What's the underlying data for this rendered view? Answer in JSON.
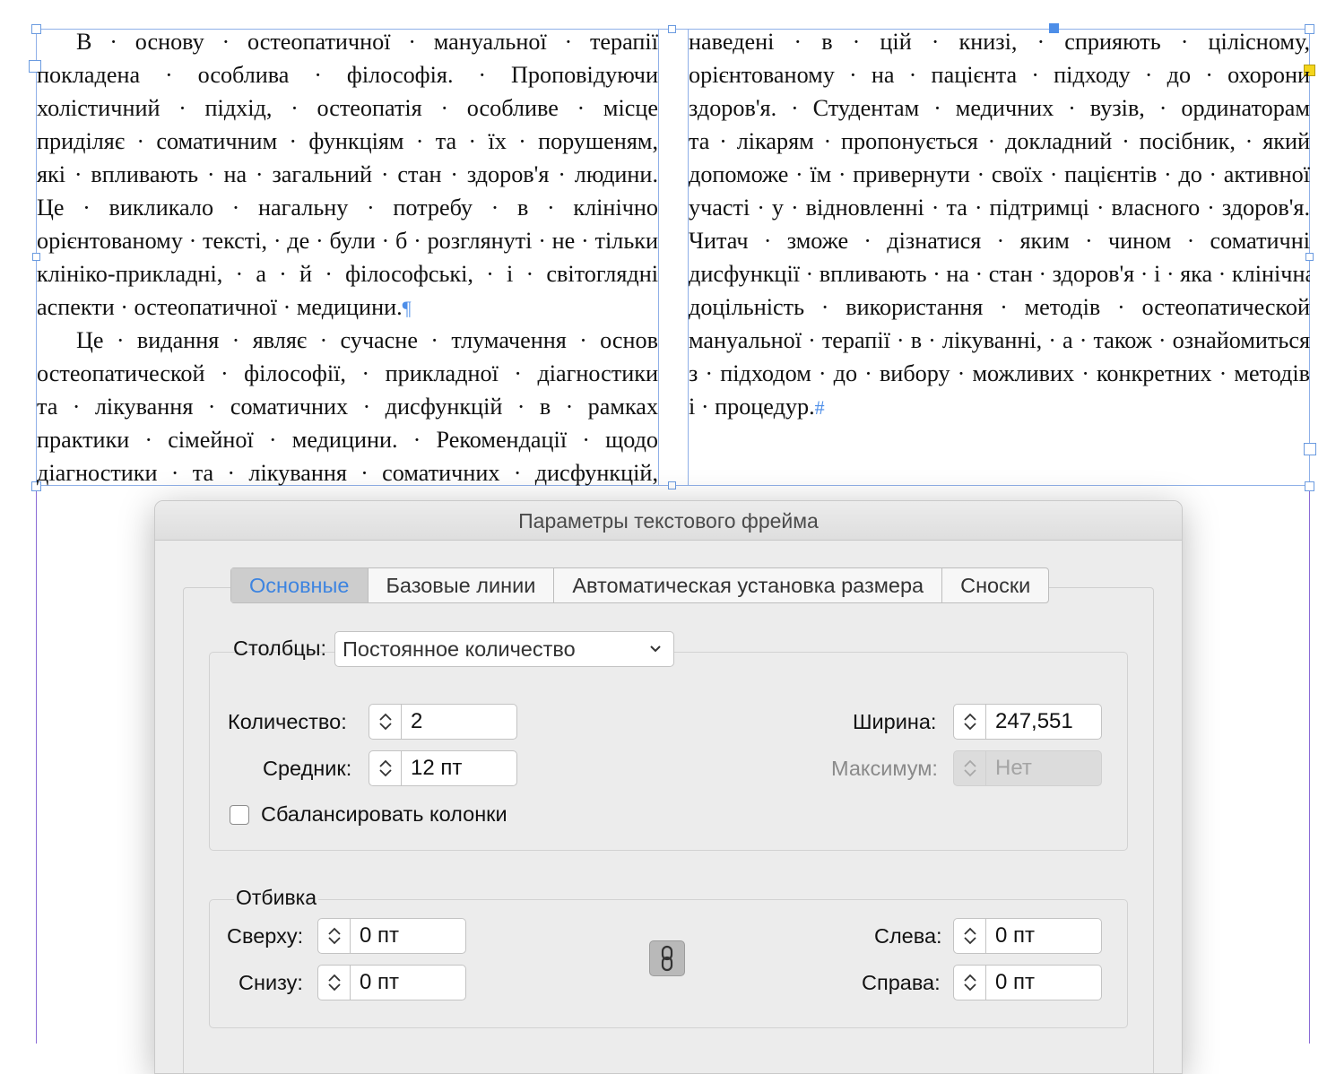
{
  "document": {
    "left_column_lines": [
      "В · основу · остеопатичної · мануальної · терапії",
      "покладена · особлива · філософія. · Проповідуючи",
      "холістичний · підхід, · остеопатія · особливе · місце",
      "приділяє · соматичним · функціям · та · їх · порушеням,",
      "які · впливають · на · загальний · стан · здоров'я · людини.",
      "Це · викликало · нагальну · потребу · в · клінічно",
      "орієнтованому · тексті, · де · були · б · розглянуті · не · тільки",
      "клініко-прикладні, · а · й · філософські, · і · світоглядні",
      "аспекти · остеопатичної · медицини.",
      "Це · видання · являє · сучасне · тлумачення · основ",
      "остеопатической · філософії, · прикладної · діагностики",
      "та · лікування · соматичних · дисфункцій · в · рамках",
      "практики · сімейної · медицини. · Рекомендації · щодо",
      "діагностики · та · лікування · соматичних · дисфункцій,"
    ],
    "right_column_lines": [
      "наведені · в · цій · книзі, · сприяють · цілісному,",
      "орієнтованому · на · пацієнта · підходу · до · охорони",
      "здоров'я. · Студентам · медичних · вузів, · ординаторам",
      "та · лікарям · пропонується · докладний · посібник, · який",
      "допоможе · їм · привернути · своїх · пацієнтів · до · активної",
      "участі · у · відновленні · та · підтримці · власного · здоров'я.",
      "Читач · зможе · дізнатися · яким · чином · соматичні",
      "дисфункції · впливають · на · стан · здоров'я · і · яка · клінічна",
      "доцільність · використання · методів · остеопатической",
      "мануальної · терапії · в · лікуванні, · а · також · ознайомиться",
      "з · підходом · до · вибору · можливих · конкретних · методів",
      "і · процедур."
    ],
    "pilcrow": "¶",
    "end_of_story": "#"
  },
  "dialog": {
    "title": "Параметры текстового фрейма",
    "tabs": [
      {
        "label": "Основные",
        "active": true
      },
      {
        "label": "Базовые линии",
        "active": false
      },
      {
        "label": "Автоматическая установка размера",
        "active": false
      },
      {
        "label": "Сноски",
        "active": false
      }
    ],
    "columns": {
      "label": "Столбцы:",
      "selected": "Постоянное количество",
      "count_label": "Количество:",
      "count_value": "2",
      "gutter_label": "Средник:",
      "gutter_value": "12 пт",
      "width_label": "Ширина:",
      "width_value": "247,551",
      "max_label": "Максимум:",
      "max_value": "Нет",
      "balance_label": "Сбалансировать колонки",
      "balance_checked": false
    },
    "inset": {
      "title": "Отбивка",
      "top_label": "Сверху:",
      "top_value": "0 пт",
      "bottom_label": "Снизу:",
      "bottom_value": "0 пт",
      "left_label": "Слева:",
      "left_value": "0 пт",
      "right_label": "Справа:",
      "right_value": "0 пт",
      "link_icon": "chain-link-icon"
    }
  },
  "colors": {
    "accent": "#3d84e0",
    "frame": "#8fb0e8",
    "margin_guide": "#8a6bd6",
    "handle_yellow": "#f4d51b"
  }
}
